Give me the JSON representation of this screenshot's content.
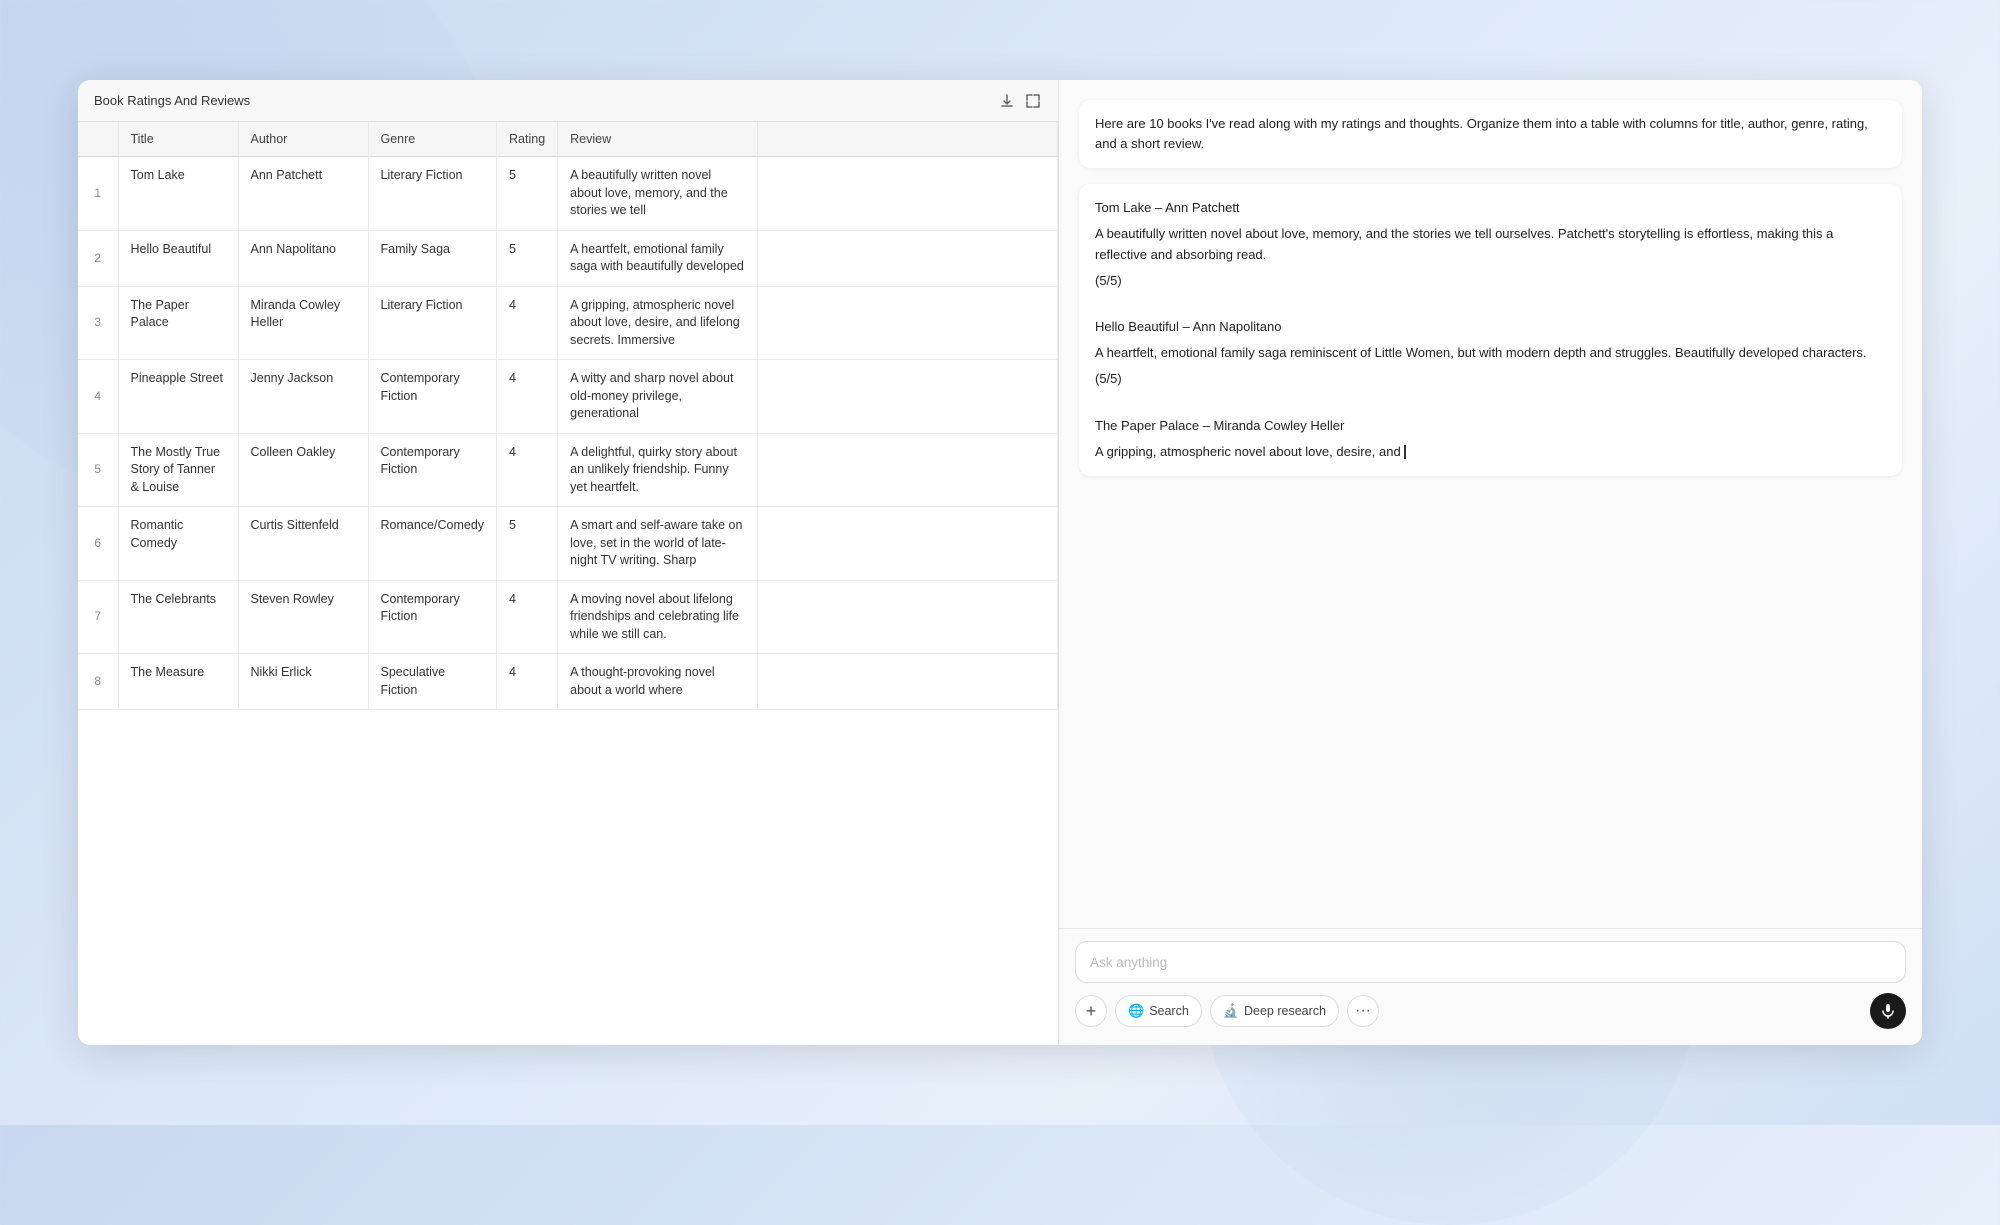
{
  "background": {
    "gradient": "linear-gradient(135deg, #c8d8f0 0%, #dce8f8 40%, #e8f0fa 70%, #d0dff5 100%)"
  },
  "spreadsheet": {
    "title": "Book Ratings And Reviews",
    "columns": [
      {
        "key": "num",
        "label": ""
      },
      {
        "key": "title",
        "label": "Title"
      },
      {
        "key": "author",
        "label": "Author"
      },
      {
        "key": "genre",
        "label": "Genre"
      },
      {
        "key": "rating",
        "label": "Rating"
      },
      {
        "key": "review",
        "label": "Review"
      }
    ],
    "rows": [
      {
        "num": 1,
        "title": "Tom Lake",
        "author": "Ann Patchett",
        "genre": "Literary Fiction",
        "rating": 5,
        "review": "A beautifully written novel about love, memory, and the stories we tell"
      },
      {
        "num": 2,
        "title": "Hello Beautiful",
        "author": "Ann Napolitano",
        "genre": "Family Saga",
        "rating": 5,
        "review": "A heartfelt, emotional family saga with beautifully developed"
      },
      {
        "num": 3,
        "title": "The Paper Palace",
        "author": "Miranda Cowley Heller",
        "genre": "Literary Fiction",
        "rating": 4,
        "review": "A gripping, atmospheric novel about love, desire, and lifelong secrets. Immersive"
      },
      {
        "num": 4,
        "title": "Pineapple Street",
        "author": "Jenny Jackson",
        "genre": "Contemporary Fiction",
        "rating": 4,
        "review": "A witty and sharp novel about old-money privilege, generational"
      },
      {
        "num": 5,
        "title": "The Mostly True Story of Tanner & Louise",
        "author": "Colleen Oakley",
        "genre": "Contemporary Fiction",
        "rating": 4,
        "review": "A delightful, quirky story about an unlikely friendship. Funny yet heartfelt."
      },
      {
        "num": 6,
        "title": "Romantic Comedy",
        "author": "Curtis Sittenfeld",
        "genre": "Romance/Comedy",
        "rating": 5,
        "review": "A smart and self-aware take on love, set in the world of late-night TV writing. Sharp"
      },
      {
        "num": 7,
        "title": "The Celebrants",
        "author": "Steven Rowley",
        "genre": "Contemporary Fiction",
        "rating": 4,
        "review": "A moving novel about lifelong friendships and celebrating life while we still can."
      },
      {
        "num": 8,
        "title": "The Measure",
        "author": "Nikki Erlick",
        "genre": "Speculative Fiction",
        "rating": 4,
        "review": "A thought-provoking novel about a world where"
      }
    ]
  },
  "chat": {
    "messages": [
      {
        "id": 1,
        "text": "Here are 10 books I've read along with my ratings and thoughts. Organize them into a table with columns for title, author, genre, rating, and a short review."
      },
      {
        "id": 2,
        "content": [
          {
            "book": "Tom Lake – Ann Patchett",
            "review": "A beautifully written novel about love, memory, and the stories we tell ourselves. Patchett's storytelling is effortless, making this a reflective and absorbing read.",
            "score": "(5/5)"
          },
          {
            "book": "Hello Beautiful – Ann Napolitano",
            "review": "A heartfelt, emotional family saga reminiscent of Little Women, but with modern depth and struggles. Beautifully developed characters.",
            "score": "(5/5)"
          },
          {
            "book": "The Paper Palace – Miranda Cowley Heller",
            "review": "A gripping, atmospheric novel about love, desire, and",
            "score": ""
          }
        ]
      }
    ],
    "input": {
      "placeholder": "Ask anything"
    },
    "toolbar": {
      "plus_label": "+",
      "search_label": "Search",
      "deep_research_label": "Deep research",
      "more_label": "···",
      "mic_label": "🎤"
    }
  }
}
